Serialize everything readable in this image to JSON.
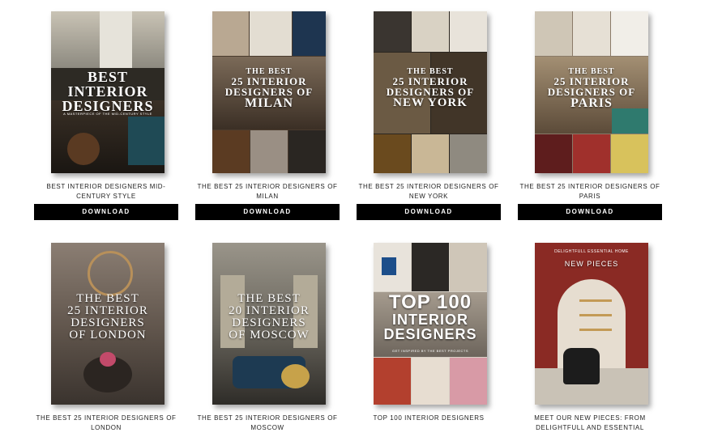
{
  "cards": [
    {
      "caption": "BEST INTERIOR DESIGNERS MID-CENTURY STYLE",
      "download": "DOWNLOAD",
      "cover": {
        "title_lines": [
          "BEST",
          "INTERIOR",
          "DESIGNERS"
        ],
        "subtitle": "A MASTERPIECE OF THE MID-CENTURY STYLE"
      }
    },
    {
      "caption": "THE BEST 25 INTERIOR DESIGNERS OF MILAN",
      "download": "DOWNLOAD",
      "cover": {
        "title_lines": [
          "THE BEST",
          "25 INTERIOR",
          "DESIGNERS OF",
          "MILAN"
        ]
      }
    },
    {
      "caption": "THE BEST 25 INTERIOR DESIGNERS OF NEW YORK",
      "download": "DOWNLOAD",
      "cover": {
        "title_lines": [
          "THE BEST",
          "25 INTERIOR",
          "DESIGNERS OF",
          "NEW YORK"
        ]
      }
    },
    {
      "caption": "THE BEST 25 INTERIOR DESIGNERS OF PARIS",
      "download": "DOWNLOAD",
      "cover": {
        "title_lines": [
          "THE BEST",
          "25 INTERIOR",
          "DESIGNERS OF",
          "PARIS"
        ]
      }
    },
    {
      "caption": "THE BEST 25 INTERIOR DESIGNERS OF LONDON",
      "cover": {
        "title_lines": [
          "THE BEST",
          "25 INTERIOR",
          "DESIGNERS",
          "OF LONDON"
        ]
      }
    },
    {
      "caption": "THE BEST 25 INTERIOR DESIGNERS OF MOSCOW",
      "cover": {
        "title_lines": [
          "THE BEST",
          "20 INTERIOR",
          "DESIGNERS",
          "OF MOSCOW"
        ]
      }
    },
    {
      "caption": "TOP 100 INTERIOR DESIGNERS",
      "cover": {
        "title_lines": [
          "TOP 100",
          "INTERIOR",
          "DESIGNERS"
        ],
        "subtitle": "GET INSPIRED BY THE BEST PROJECTS"
      }
    },
    {
      "caption": "MEET OUR NEW PIECES: FROM DELIGHTFULL AND ESSENTIAL",
      "cover": {
        "title_lines": [
          "NEW PIECES"
        ],
        "brand": "DELIGHTFULL  ESSENTIAL HOME"
      }
    }
  ]
}
